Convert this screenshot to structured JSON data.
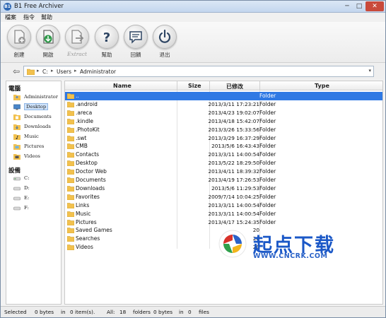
{
  "window": {
    "title": "B1 Free Archiver",
    "minimize": "─",
    "maximize": "□",
    "close": "✕"
  },
  "menu": [
    "檔案",
    "指令",
    "幫助"
  ],
  "toolbar": [
    {
      "label": "創建",
      "icon": "create-archive-icon",
      "enabled": false
    },
    {
      "label": "開啟",
      "icon": "open-archive-icon",
      "enabled": true
    },
    {
      "label": "Extract",
      "icon": "extract-icon",
      "enabled": false
    },
    {
      "label": "幫助",
      "icon": "help-icon",
      "enabled": true
    },
    {
      "label": "回饋",
      "icon": "feedback-icon",
      "enabled": true
    },
    {
      "label": "退出",
      "icon": "power-icon",
      "enabled": true
    }
  ],
  "address": {
    "back": "⇦",
    "crumbs": [
      "C:",
      "Users",
      "Administrator"
    ],
    "separator": "▸",
    "dropdown": "▾"
  },
  "sidebar": {
    "places_heading": "電腦",
    "places": [
      {
        "label": "Administrator",
        "icon": "user-folder-icon"
      },
      {
        "label": "Desktop",
        "icon": "desktop-icon",
        "selected": true
      },
      {
        "label": "Documents",
        "icon": "documents-icon"
      },
      {
        "label": "Downloads",
        "icon": "downloads-icon"
      },
      {
        "label": "Music",
        "icon": "music-icon"
      },
      {
        "label": "Pictures",
        "icon": "pictures-icon"
      },
      {
        "label": "Videos",
        "icon": "videos-icon"
      }
    ],
    "devices_heading": "設備",
    "devices": [
      {
        "label": "C:",
        "icon": "drive-icon"
      },
      {
        "label": "D:",
        "icon": "drive-icon"
      },
      {
        "label": "E:",
        "icon": "drive-icon"
      },
      {
        "label": "F:",
        "icon": "drive-icon"
      }
    ]
  },
  "columns": {
    "name": "Name",
    "size": "Size",
    "modified": "已修改",
    "type": "Type"
  },
  "files": [
    {
      "name": "..",
      "date": "",
      "type": "Folder",
      "selected": true
    },
    {
      "name": ".android",
      "date": "2013/3/11 17:23:21",
      "type": "Folder"
    },
    {
      "name": ".areca",
      "date": "2013/4/23 19:02:07",
      "type": "Folder"
    },
    {
      "name": ".kindle",
      "date": "2013/4/18 15:42:07",
      "type": "Folder"
    },
    {
      "name": ".PhotoKit",
      "date": "2013/3/26 15:33:56",
      "type": "Folder"
    },
    {
      "name": ".swt",
      "date": "2013/3/29 16:37:29",
      "type": "Folder"
    },
    {
      "name": "CMB",
      "date": "2013/5/6 16:43:43",
      "type": "Folder"
    },
    {
      "name": "Contacts",
      "date": "2013/3/11 14:00:54",
      "type": "Folder"
    },
    {
      "name": "Desktop",
      "date": "2013/5/22 18:29:50",
      "type": "Folder"
    },
    {
      "name": "Doctor Web",
      "date": "2013/4/11 18:39:32",
      "type": "Folder"
    },
    {
      "name": "Documents",
      "date": "2013/4/19 17:26:53",
      "type": "Folder"
    },
    {
      "name": "Downloads",
      "date": "2013/5/6 11:29:53",
      "type": "Folder"
    },
    {
      "name": "Favorites",
      "date": "2009/7/14 10:04:25",
      "type": "Folder"
    },
    {
      "name": "Links",
      "date": "2013/3/11 14:00:54",
      "type": "Folder"
    },
    {
      "name": "Music",
      "date": "2013/3/11 14:00:54",
      "type": "Folder"
    },
    {
      "name": "Pictures",
      "date": "2013/4/17 15:24:35",
      "type": "Folder"
    },
    {
      "name": "Saved Games",
      "date": "20",
      "type": ""
    },
    {
      "name": "Searches",
      "date": "20",
      "type": ""
    },
    {
      "name": "Videos",
      "date": "20",
      "type": ""
    }
  ],
  "watermark": {
    "text": "起点下载",
    "url": "WWW.CNCRK.COM"
  },
  "status": {
    "selected_label": "Selected",
    "selected_bytes": "0 bytes",
    "in1": "in",
    "selected_items": "0 item(s).",
    "all_label": "All:",
    "all_folders_count": "18",
    "folders": "folders",
    "all_bytes": "0 bytes",
    "in2": "in",
    "files_count": "0",
    "files": "files"
  },
  "colors": {
    "selection": "#2f79e4",
    "folder": "#f2c14e",
    "accent": "#2f68b4"
  }
}
